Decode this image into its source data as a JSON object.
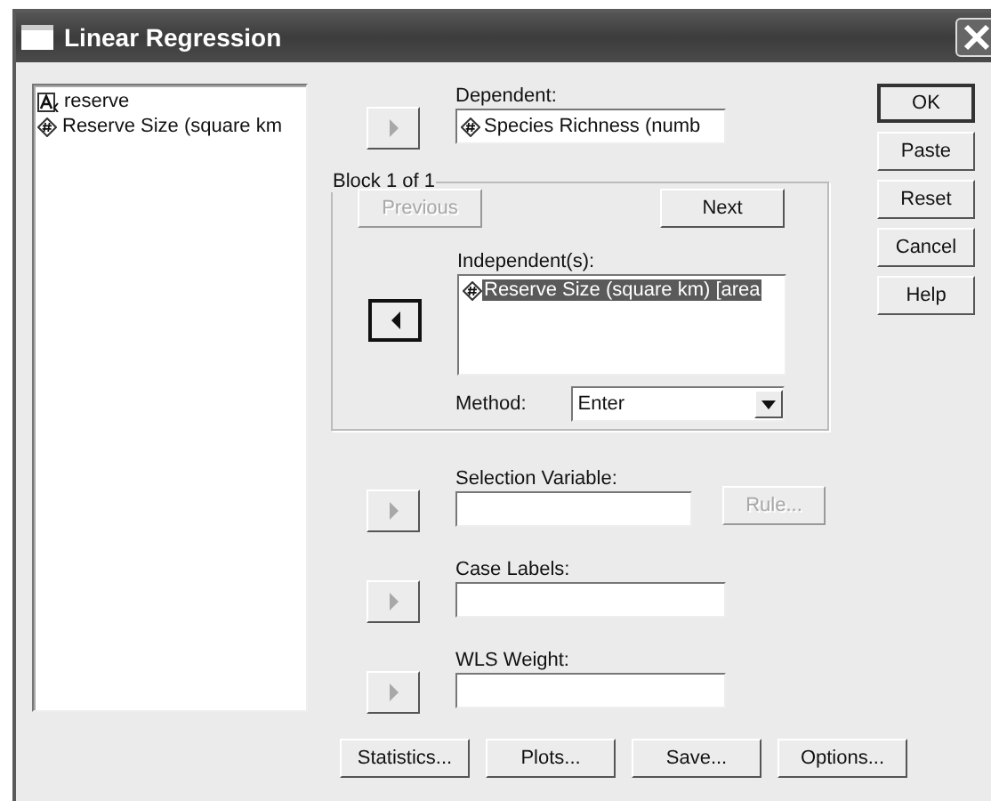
{
  "window": {
    "title": "Linear Regression"
  },
  "variables": [
    {
      "name": "reserve",
      "kind": "string"
    },
    {
      "name": "Reserve Size (square km",
      "kind": "numeric"
    }
  ],
  "dependent": {
    "label": "Dependent:",
    "arrow": {
      "kind": "right",
      "disabled": true
    },
    "value": "Species Richness (numb",
    "kind": "numeric"
  },
  "block": {
    "title": "Block 1 of 1",
    "previous": {
      "label": "Previous",
      "disabled": true
    },
    "next": {
      "label": "Next",
      "disabled": false
    },
    "independents_label": "Independent(s):",
    "arrow": {
      "kind": "left",
      "disabled": false
    },
    "independents": [
      {
        "name": "Reserve Size (square km) [area",
        "kind": "numeric",
        "selected": true
      }
    ],
    "method_label": "Method:",
    "method": "Enter"
  },
  "fields": [
    {
      "label": "Selection Variable:",
      "arrow": {
        "kind": "right",
        "disabled": true
      },
      "button": {
        "label": "Rule...",
        "disabled": true
      }
    },
    {
      "label": "Case Labels:",
      "arrow": {
        "kind": "right",
        "disabled": true
      }
    },
    {
      "label": "WLS Weight:",
      "arrow": {
        "kind": "right",
        "disabled": true
      }
    }
  ],
  "side_buttons": [
    {
      "label": "OK",
      "default": true
    },
    {
      "label": "Paste",
      "default": false
    },
    {
      "label": "Reset",
      "default": false
    },
    {
      "label": "Cancel",
      "default": false
    },
    {
      "label": "Help",
      "default": false
    }
  ],
  "bottom_buttons": [
    "Statistics...",
    "Plots...",
    "Save...",
    "Options..."
  ]
}
